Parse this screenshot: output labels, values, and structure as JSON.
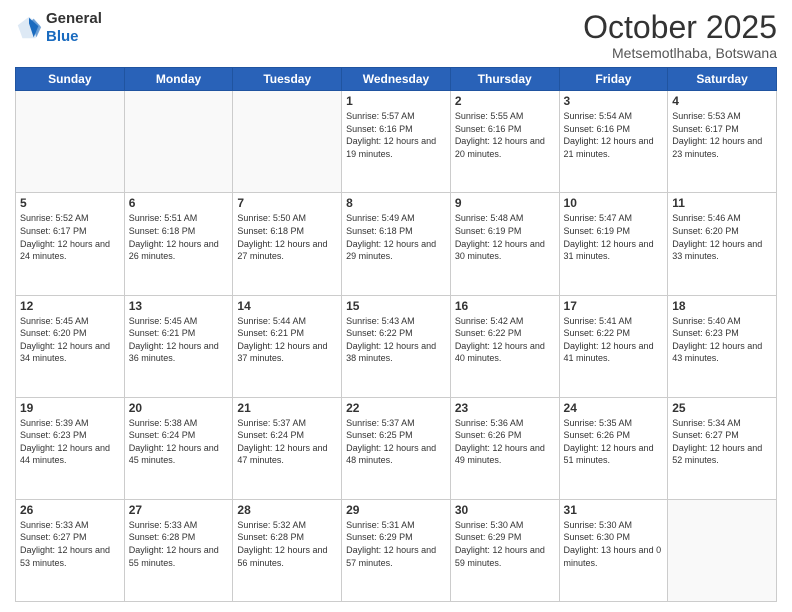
{
  "header": {
    "logo_general": "General",
    "logo_blue": "Blue",
    "month_title": "October 2025",
    "location": "Metsemotlhaba, Botswana"
  },
  "days_of_week": [
    "Sunday",
    "Monday",
    "Tuesday",
    "Wednesday",
    "Thursday",
    "Friday",
    "Saturday"
  ],
  "weeks": [
    [
      {
        "day": "",
        "sunrise": "",
        "sunset": "",
        "daylight": "",
        "empty": true
      },
      {
        "day": "",
        "sunrise": "",
        "sunset": "",
        "daylight": "",
        "empty": true
      },
      {
        "day": "",
        "sunrise": "",
        "sunset": "",
        "daylight": "",
        "empty": true
      },
      {
        "day": "1",
        "sunrise": "5:57 AM",
        "sunset": "6:16 PM",
        "daylight": "12 hours and 19 minutes."
      },
      {
        "day": "2",
        "sunrise": "5:55 AM",
        "sunset": "6:16 PM",
        "daylight": "12 hours and 20 minutes."
      },
      {
        "day": "3",
        "sunrise": "5:54 AM",
        "sunset": "6:16 PM",
        "daylight": "12 hours and 21 minutes."
      },
      {
        "day": "4",
        "sunrise": "5:53 AM",
        "sunset": "6:17 PM",
        "daylight": "12 hours and 23 minutes."
      }
    ],
    [
      {
        "day": "5",
        "sunrise": "5:52 AM",
        "sunset": "6:17 PM",
        "daylight": "12 hours and 24 minutes."
      },
      {
        "day": "6",
        "sunrise": "5:51 AM",
        "sunset": "6:18 PM",
        "daylight": "12 hours and 26 minutes."
      },
      {
        "day": "7",
        "sunrise": "5:50 AM",
        "sunset": "6:18 PM",
        "daylight": "12 hours and 27 minutes."
      },
      {
        "day": "8",
        "sunrise": "5:49 AM",
        "sunset": "6:18 PM",
        "daylight": "12 hours and 29 minutes."
      },
      {
        "day": "9",
        "sunrise": "5:48 AM",
        "sunset": "6:19 PM",
        "daylight": "12 hours and 30 minutes."
      },
      {
        "day": "10",
        "sunrise": "5:47 AM",
        "sunset": "6:19 PM",
        "daylight": "12 hours and 31 minutes."
      },
      {
        "day": "11",
        "sunrise": "5:46 AM",
        "sunset": "6:20 PM",
        "daylight": "12 hours and 33 minutes."
      }
    ],
    [
      {
        "day": "12",
        "sunrise": "5:45 AM",
        "sunset": "6:20 PM",
        "daylight": "12 hours and 34 minutes."
      },
      {
        "day": "13",
        "sunrise": "5:45 AM",
        "sunset": "6:21 PM",
        "daylight": "12 hours and 36 minutes."
      },
      {
        "day": "14",
        "sunrise": "5:44 AM",
        "sunset": "6:21 PM",
        "daylight": "12 hours and 37 minutes."
      },
      {
        "day": "15",
        "sunrise": "5:43 AM",
        "sunset": "6:22 PM",
        "daylight": "12 hours and 38 minutes."
      },
      {
        "day": "16",
        "sunrise": "5:42 AM",
        "sunset": "6:22 PM",
        "daylight": "12 hours and 40 minutes."
      },
      {
        "day": "17",
        "sunrise": "5:41 AM",
        "sunset": "6:22 PM",
        "daylight": "12 hours and 41 minutes."
      },
      {
        "day": "18",
        "sunrise": "5:40 AM",
        "sunset": "6:23 PM",
        "daylight": "12 hours and 43 minutes."
      }
    ],
    [
      {
        "day": "19",
        "sunrise": "5:39 AM",
        "sunset": "6:23 PM",
        "daylight": "12 hours and 44 minutes."
      },
      {
        "day": "20",
        "sunrise": "5:38 AM",
        "sunset": "6:24 PM",
        "daylight": "12 hours and 45 minutes."
      },
      {
        "day": "21",
        "sunrise": "5:37 AM",
        "sunset": "6:24 PM",
        "daylight": "12 hours and 47 minutes."
      },
      {
        "day": "22",
        "sunrise": "5:37 AM",
        "sunset": "6:25 PM",
        "daylight": "12 hours and 48 minutes."
      },
      {
        "day": "23",
        "sunrise": "5:36 AM",
        "sunset": "6:26 PM",
        "daylight": "12 hours and 49 minutes."
      },
      {
        "day": "24",
        "sunrise": "5:35 AM",
        "sunset": "6:26 PM",
        "daylight": "12 hours and 51 minutes."
      },
      {
        "day": "25",
        "sunrise": "5:34 AM",
        "sunset": "6:27 PM",
        "daylight": "12 hours and 52 minutes."
      }
    ],
    [
      {
        "day": "26",
        "sunrise": "5:33 AM",
        "sunset": "6:27 PM",
        "daylight": "12 hours and 53 minutes."
      },
      {
        "day": "27",
        "sunrise": "5:33 AM",
        "sunset": "6:28 PM",
        "daylight": "12 hours and 55 minutes."
      },
      {
        "day": "28",
        "sunrise": "5:32 AM",
        "sunset": "6:28 PM",
        "daylight": "12 hours and 56 minutes."
      },
      {
        "day": "29",
        "sunrise": "5:31 AM",
        "sunset": "6:29 PM",
        "daylight": "12 hours and 57 minutes."
      },
      {
        "day": "30",
        "sunrise": "5:30 AM",
        "sunset": "6:29 PM",
        "daylight": "12 hours and 59 minutes."
      },
      {
        "day": "31",
        "sunrise": "5:30 AM",
        "sunset": "6:30 PM",
        "daylight": "13 hours and 0 minutes."
      },
      {
        "day": "",
        "sunrise": "",
        "sunset": "",
        "daylight": "",
        "empty": true
      }
    ]
  ],
  "labels": {
    "sunrise_prefix": "Sunrise: ",
    "sunset_prefix": "Sunset: ",
    "daylight_prefix": "Daylight: "
  }
}
